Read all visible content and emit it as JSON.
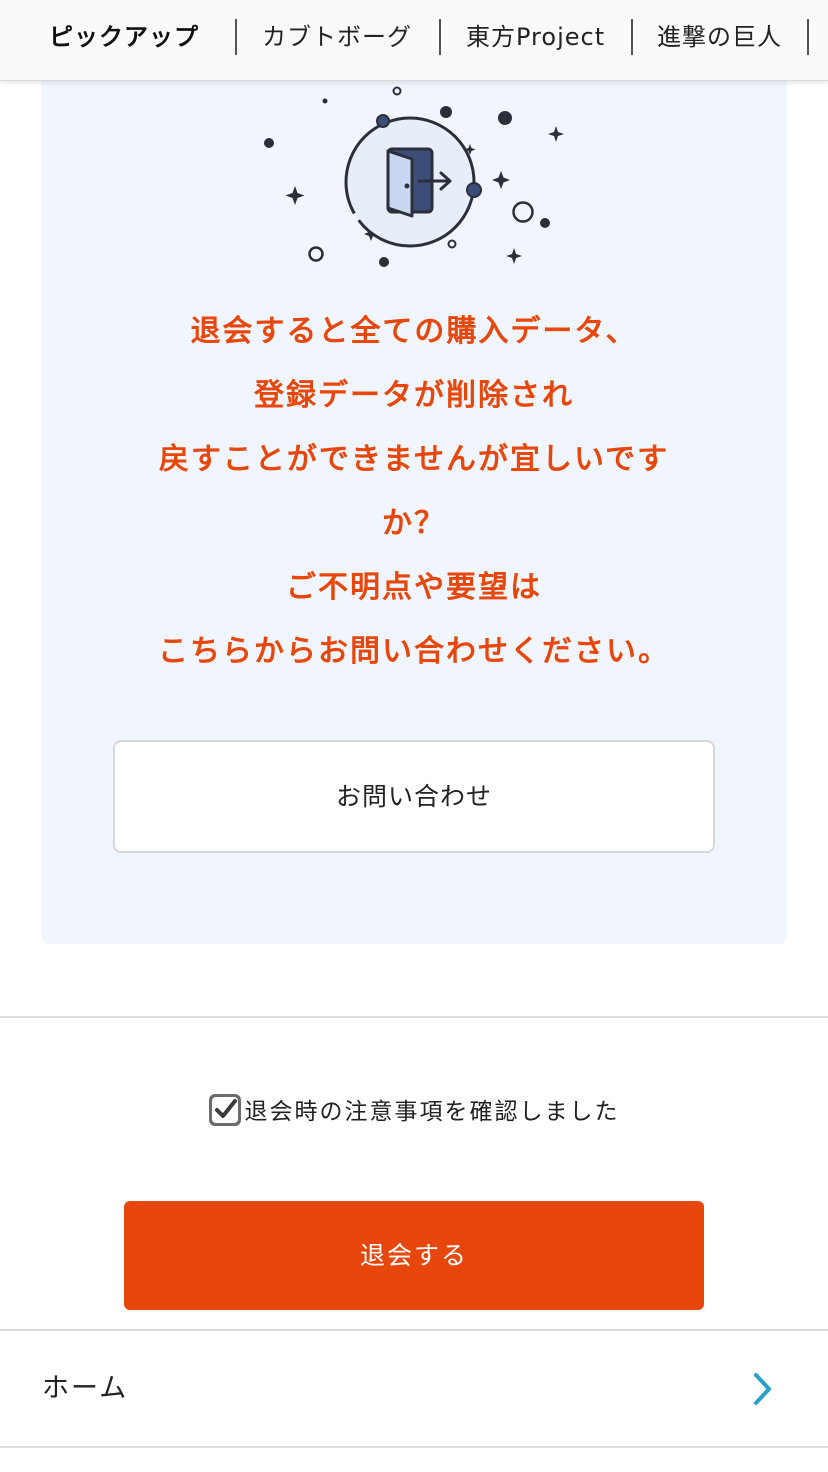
{
  "tabs": [
    {
      "label": "ピックアップ",
      "active": true
    },
    {
      "label": "カブトボーグ",
      "active": false
    },
    {
      "label": "東方Project",
      "active": false
    },
    {
      "label": "進撃の巨人",
      "active": false
    }
  ],
  "notice": {
    "illustration_icon": "door-exit-icon",
    "warning_lines": [
      "退会すると全ての購入データ、",
      "登録データが削除され",
      "戻すことができませんが宜しいです",
      "か？",
      "ご不明点や要望は",
      "こちらからお問い合わせください。"
    ],
    "contact_button": "お問い合わせ"
  },
  "confirm": {
    "label": "退会時の注意事項を確認しました",
    "checked": true
  },
  "withdraw_button": "退会する",
  "nav": {
    "home_label": "ホーム",
    "chevron_icon": "chevron-right-icon"
  },
  "colors": {
    "accent": "#e8470b",
    "panel_bg": "#f1f5fd",
    "chevron": "#2aa0c8"
  }
}
